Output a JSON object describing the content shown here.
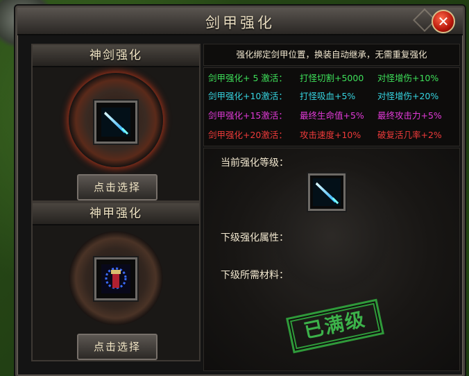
{
  "window": {
    "title": "剑甲强化"
  },
  "sword_panel": {
    "header": "神剑强化",
    "button": "点击选择"
  },
  "armor_panel": {
    "header": "神甲强化",
    "button": "点击选择"
  },
  "notice": "强化绑定剑甲位置，换装自动继承，无需重复强化",
  "bonuses": [
    {
      "level": "剑甲强化+ 5 激活：",
      "attr1": "打怪切割+5000",
      "attr2": "对怪增伤+10%",
      "color": "#3ee05a"
    },
    {
      "level": "剑甲强化+10激活：",
      "attr1": "打怪吸血+5%",
      "attr2": "对怪增伤+20%",
      "color": "#36d4e0"
    },
    {
      "level": "剑甲强化+15激活：",
      "attr1": "最终生命值+5%",
      "attr2": "最终攻击力+5%",
      "color": "#e23ad8"
    },
    {
      "level": "剑甲强化+20激活：",
      "attr1": "攻击速度+10%",
      "attr2": "破复活几率+2%",
      "color": "#ee3a3a"
    }
  ],
  "detail": {
    "current_level_label": "当前强化等级：",
    "next_attr_label": "下级强化属性：",
    "next_material_label": "下级所需材料：",
    "max_stamp": "已满级"
  },
  "icons": {
    "sword": "sword-icon",
    "armor": "armor-icon",
    "close": "close-icon"
  }
}
